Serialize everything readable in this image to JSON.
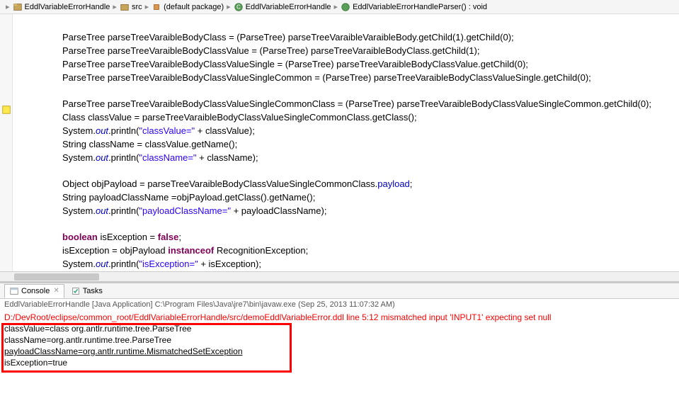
{
  "breadcrumb": {
    "items": [
      {
        "label": "EddlVariableErrorHandle",
        "icon": "project"
      },
      {
        "label": "src",
        "icon": "folder"
      },
      {
        "label": "(default package)",
        "icon": "package"
      },
      {
        "label": "EddlVariableErrorHandle",
        "icon": "class"
      },
      {
        "label": "EddlVariableErrorHandleParser() : void",
        "icon": "method"
      }
    ]
  },
  "code": {
    "l1a": "ParseTree parseTreeVaraibleBodyClass = (ParseTree) parseTreeVaraibleVaraibleBody.getChild(1).getChild(0);",
    "l2a": "ParseTree parseTreeVaraibleBodyClassValue = (ParseTree) parseTreeVaraibleBodyClass.getChild(1);",
    "l3a": "ParseTree parseTreeVaraibleBodyClassValueSingle = (ParseTree) parseTreeVaraibleBodyClassValue.getChild(0);",
    "l4a": "ParseTree parseTreeVaraibleBodyClassValueSingleCommon = (ParseTree) parseTreeVaraibleBodyClassValueSingle.getChild(0);",
    "l5a": "ParseTree parseTreeVaraibleBodyClassValueSingleCommonClass = (ParseTree) parseTreeVaraibleBodyClassValueSingleCommon.getChild(0);",
    "l6a": "Class classValue = parseTreeVaraibleBodyClassValueSingleCommonClass.getClass();",
    "l7_pre": "System.",
    "l7_out": "out",
    "l7_mid": ".println(",
    "l7_str": "\"classValue=\"",
    "l7_post": " + classValue);",
    "l8a": "String className = classValue.getName();",
    "l9_pre": "System.",
    "l9_out": "out",
    "l9_mid": ".println(",
    "l9_str": "\"className=\"",
    "l9_post": " + className);",
    "l10a": "Object objPayload = parseTreeVaraibleBodyClassValueSingleCommonClass.",
    "l10_fld": "payload",
    "l10_post": ";",
    "l11a": "String payloadClassName =objPayload.getClass().getName();",
    "l12_pre": "System.",
    "l12_out": "out",
    "l12_mid": ".println(",
    "l12_str": "\"payloadClassName=\"",
    "l12_post": " + payloadClassName);",
    "l13_kw1": "boolean",
    "l13_mid": " isException = ",
    "l13_kw2": "false",
    "l13_post": ";",
    "l14_pre": "isException = objPayload ",
    "l14_kw": "instanceof",
    "l14_post": " RecognitionException;",
    "l15_pre": "System.",
    "l15_out": "out",
    "l15_mid": ".println(",
    "l15_str": "\"isException=\"",
    "l15_post": " + isException);"
  },
  "consoleTabs": {
    "console": "Console",
    "tasks": "Tasks"
  },
  "consoleHeader": "EddlVariableErrorHandle [Java Application] C:\\Program Files\\Java\\jre7\\bin\\javaw.exe (Sep 25, 2013 11:07:32 AM)",
  "consoleLines": {
    "err": "D:/DevRoot/eclipse/common_root/EddlVariableErrorHandle/src/demoEddlVariableError.ddl line 5:12 mismatched input 'INPUT1' expecting set null",
    "l1": "classValue=class org.antlr.runtime.tree.ParseTree",
    "l2": "className=org.antlr.runtime.tree.ParseTree",
    "l3": "payloadClassName=org.antlr.runtime.MismatchedSetException",
    "l4": "isException=true"
  }
}
